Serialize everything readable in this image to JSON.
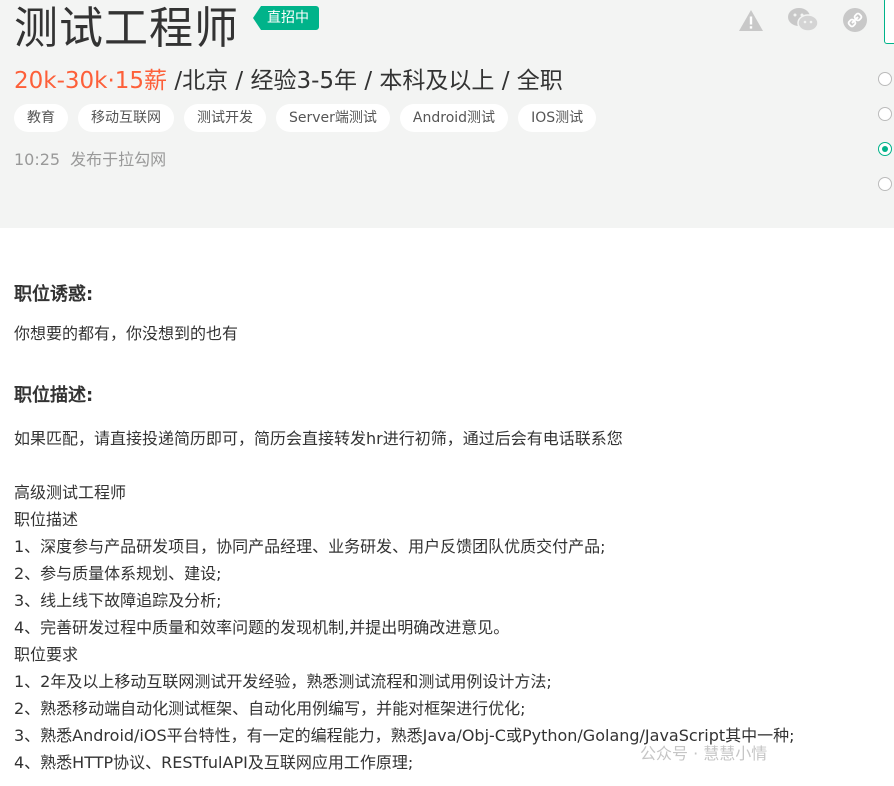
{
  "job": {
    "title": "测试工程师",
    "badge": "直招中",
    "salary": "20k-30k·15薪",
    "details": " /北京 / 经验3-5年 / 本科及以上 / 全职",
    "tags": [
      "教育",
      "移动互联网",
      "测试开发",
      "Server端测试",
      "Android测试",
      "IOS测试"
    ],
    "publish_time": "10:25",
    "publish_source": "发布于拉勾网"
  },
  "icons": {
    "report": "warning-icon",
    "wechat": "wechat-icon",
    "link": "link-icon"
  },
  "colors": {
    "accent": "#00b38a",
    "salary": "#fd5f39",
    "header_bg": "#f3f4f3"
  },
  "content": {
    "perk_title": "职位诱惑:",
    "perk_text": "你想要的都有，你没想到的也有",
    "desc_title": "职位描述:",
    "lines": [
      "如果匹配，请直接投递简历即可，简历会直接转发hr进行初筛，通过后会有电话联系您",
      "",
      "高级测试工程师",
      "职位描述",
      "1、深度参与产品研发项目，协同产品经理、业务研发、用户反馈团队优质交付产品;",
      "2、参与质量体系规划、建设;",
      "3、线上线下故障追踪及分析;",
      "4、完善研发过程中质量和效率问题的发现机制,并提出明确改进意见。",
      "职位要求",
      "1、2年及以上移动互联网测试开发经验，熟悉测试流程和测试用例设计方法;",
      "2、熟悉移动端自动化测试框架、自动化用例编写，并能对框架进行优化;",
      "3、熟悉Android/iOS平台特性，有一定的编程能力，熟悉Java/Obj-C或Python/Golang/JavaScript其中一种;",
      "4、熟悉HTTP协议、RESTfulAPI及互联网应用工作原理;"
    ]
  },
  "watermark": "公众号 · 慧慧小情"
}
